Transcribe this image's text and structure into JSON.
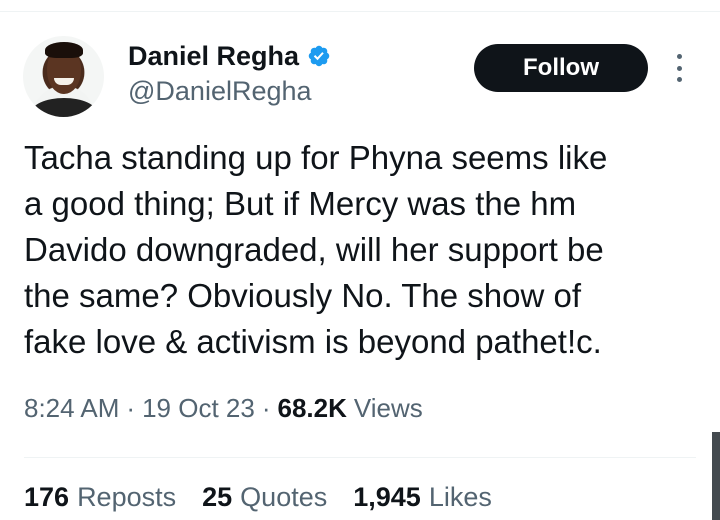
{
  "author": {
    "display_name": "Daniel Regha",
    "handle": "@DanielRegha",
    "verified": true
  },
  "follow_label": "Follow",
  "tweet": {
    "lines": [
      "Tacha standing up for Phyna seems like",
      "a good thing; But if Mercy was the hm",
      "Davido downgraded, will her support be",
      "the same? Obviously No. The show of",
      "fake love & activism is beyond pathet!c."
    ]
  },
  "meta": {
    "time": "8:24 AM",
    "date": "19 Oct 23",
    "separator": "·",
    "views_count": "68.2K",
    "views_label": "Views"
  },
  "stats": {
    "reposts_count": "176",
    "reposts_label": "Reposts",
    "quotes_count": "25",
    "quotes_label": "Quotes",
    "likes_count": "1,945",
    "likes_label": "Likes"
  },
  "colors": {
    "text_primary": "#0f1419",
    "text_secondary": "#536471",
    "verified_blue": "#1d9bf0",
    "button_bg": "#0f1419"
  },
  "icons": {
    "verified": "verified-badge-icon",
    "more": "more-vertical-icon"
  }
}
